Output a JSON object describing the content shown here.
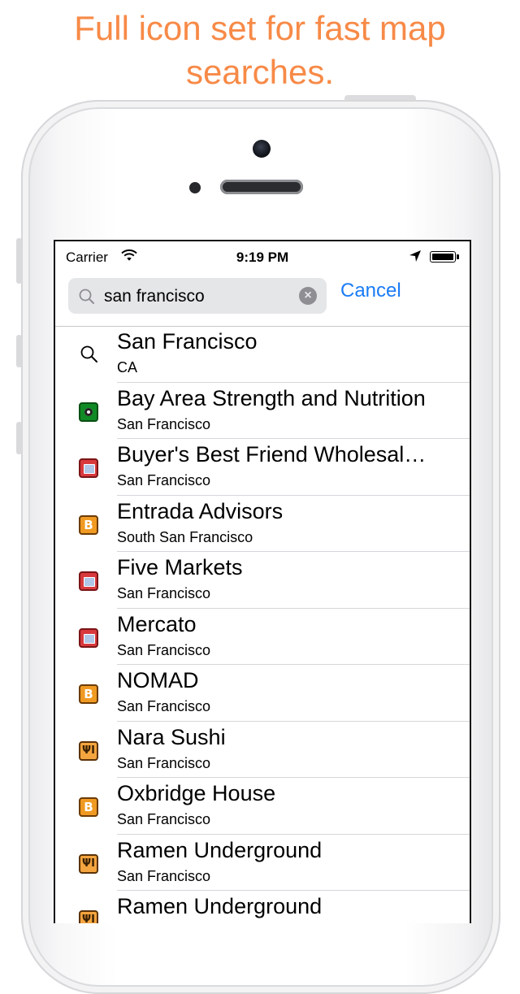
{
  "headline": {
    "line1": "Full icon set for fast map",
    "line2": "searches."
  },
  "status_bar": {
    "carrier": "Carrier",
    "time": "9:19 PM"
  },
  "search": {
    "query": "san francisco",
    "cancel_label": "Cancel"
  },
  "results": [
    {
      "title": "San Francisco",
      "subtitle": "CA",
      "icon": "search-icon"
    },
    {
      "title": "Bay Area Strength and Nutrition",
      "subtitle": "San Francisco",
      "icon": "soccer-icon"
    },
    {
      "title": "Buyer's Best Friend Wholesal…",
      "subtitle": "San Francisco",
      "icon": "grocery-icon"
    },
    {
      "title": "Entrada Advisors",
      "subtitle": "South San Francisco",
      "icon": "bitcoin-icon"
    },
    {
      "title": "Five Markets",
      "subtitle": "San Francisco",
      "icon": "grocery-icon"
    },
    {
      "title": "Mercato",
      "subtitle": "San Francisco",
      "icon": "grocery-icon"
    },
    {
      "title": "NOMAD",
      "subtitle": "San Francisco",
      "icon": "bitcoin-icon"
    },
    {
      "title": "Nara Sushi",
      "subtitle": "San Francisco",
      "icon": "restaurant-icon"
    },
    {
      "title": "Oxbridge House",
      "subtitle": "San Francisco",
      "icon": "bitcoin-icon"
    },
    {
      "title": "Ramen Underground",
      "subtitle": "San Francisco",
      "icon": "restaurant-icon"
    },
    {
      "title": "Ramen Underground",
      "subtitle": "",
      "icon": "restaurant-icon"
    }
  ],
  "colors": {
    "headline": "#f78a47",
    "accent": "#1a7cf5"
  }
}
